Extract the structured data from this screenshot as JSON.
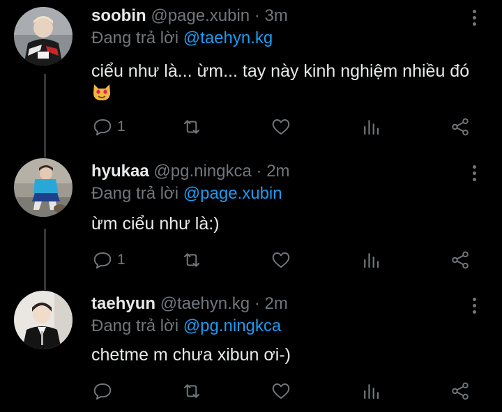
{
  "tweets": [
    {
      "name": "soobin",
      "handle": "@page.xubin",
      "dot": "·",
      "time": "3m",
      "reply_prefix": "Đang trả lời",
      "reply_to": "@taehyn.kg",
      "text": "ciểu như là... ừm... tay này kinh nghiệm nhiều đó",
      "emoji": "heart-eyes-cat",
      "reply_count": "1",
      "icons": [
        "reply-icon",
        "retweet-icon",
        "like-icon",
        "analytics-icon",
        "share-icon"
      ]
    },
    {
      "name": "hyukaa",
      "handle": "@pg.ningkca",
      "dot": "·",
      "time": "2m",
      "reply_prefix": "Đang trả lời",
      "reply_to": "@page.xubin",
      "text": "ừm ciểu như là:)",
      "reply_count": "1",
      "icons": [
        "reply-icon",
        "retweet-icon",
        "like-icon",
        "analytics-icon",
        "share-icon"
      ]
    },
    {
      "name": "taehyun",
      "handle": "@taehyn.kg",
      "dot": "·",
      "time": "2m",
      "reply_prefix": "Đang trả lời",
      "reply_to": "@pg.ningkca",
      "text": "chetme m chưa xibun ơi-)",
      "reply_count": "",
      "icons": [
        "reply-icon",
        "retweet-icon",
        "like-icon",
        "analytics-icon",
        "share-icon"
      ]
    }
  ],
  "colors": {
    "background": "#000000",
    "text": "#e7e9ea",
    "muted": "#71767b",
    "link": "#1d9bf0",
    "thread_line": "#333639"
  }
}
